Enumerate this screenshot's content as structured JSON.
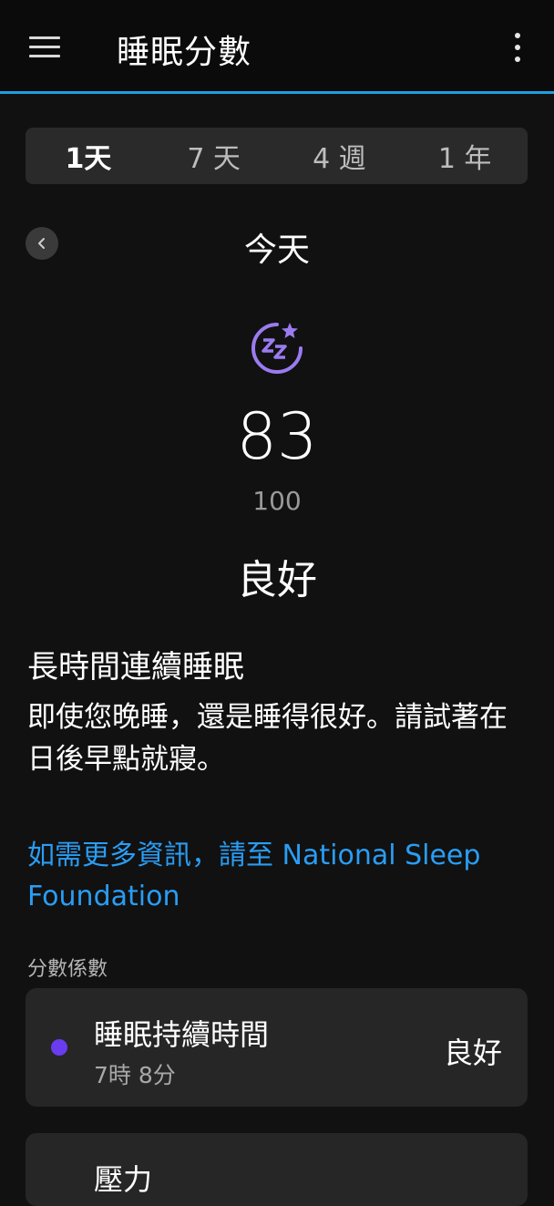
{
  "header": {
    "title": "睡眠分數"
  },
  "tabs": [
    {
      "label": "1天",
      "active": true
    },
    {
      "label": "7 天",
      "active": false
    },
    {
      "label": "4 週",
      "active": false
    },
    {
      "label": "1 年",
      "active": false
    }
  ],
  "date_label": "今天",
  "score": {
    "value": "83",
    "max": "100",
    "rating": "良好"
  },
  "insight": {
    "title": "長時間連續睡眠",
    "body": "即使您晚睡，還是睡得很好。請試著在日後早點就寢。"
  },
  "more_info": "如需更多資訊，請至 National Sleep Foundation",
  "factors": {
    "label": "分數係數",
    "items": [
      {
        "title": "睡眠持續時間",
        "subtitle": "7時 8分",
        "status": "良好",
        "dot_color": "#6a3cf0"
      },
      {
        "title": "壓力",
        "subtitle": "",
        "status": ""
      }
    ]
  },
  "colors": {
    "accent": "#1fa0e0",
    "link": "#2a9df4",
    "sleep_icon": "#9b7bf0"
  },
  "icons": {
    "menu": "menu-icon",
    "more": "more-vert-icon",
    "back": "chevron-left-icon",
    "sleep": "sleep-zz-star-icon"
  }
}
